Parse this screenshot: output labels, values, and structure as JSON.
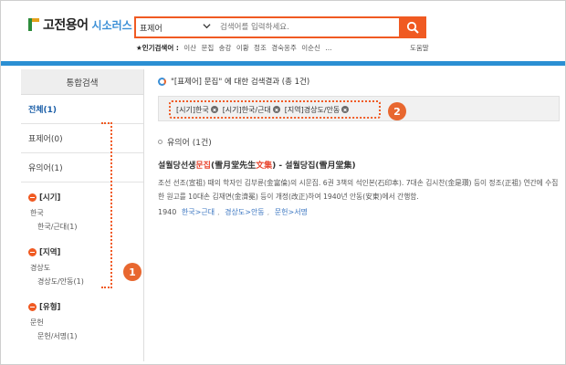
{
  "header": {
    "logo_main": "고전용어",
    "logo_sub": "시소러스",
    "search": {
      "select_value": "표제어",
      "placeholder": "검색어를 입력하세요."
    },
    "popular": {
      "label": "★인기검색어 :",
      "keywords": [
        "이산",
        "문집",
        "송강",
        "이황",
        "정조",
        "경숙옹주",
        "이순신",
        "..."
      ]
    },
    "help": "도움말"
  },
  "sidebar": {
    "title": "통합검색",
    "items": [
      {
        "label": "전체(1)",
        "active": true
      },
      {
        "label": "표제어(0)",
        "active": false
      },
      {
        "label": "유의어(1)",
        "active": false
      }
    ],
    "facets": [
      {
        "head": "[시기]",
        "item": "한국",
        "sub": "한국/근대(1)"
      },
      {
        "head": "[지역]",
        "item": "경상도",
        "sub": "경상도/안동(1)"
      },
      {
        "head": "[유형]",
        "item": "문헌",
        "sub": "문헌/서명(1)"
      }
    ]
  },
  "main": {
    "result_header": "\"[표제어] 문집\" 에 대한 검색결과 (총 1건)",
    "chips": [
      "[시기]한국",
      "[시기]한국/근대",
      "[지역]경상도/안동"
    ],
    "section_title": "유의어 (1건)",
    "entry": {
      "title_pre": "설월당선생",
      "title_hl": "문집",
      "title_mid": "(雪月堂先生",
      "title_hl2": "文集",
      "title_post": ")  - 설월당집(雪月堂集)",
      "desc": "조선 선조(宣祖) 때의 학자인 김부륜(金富倫)의 시문집. 6권 3책의 석인본(石印本). 7대손 김시찬(金是瓚) 등이 정조(正祖) 연간에 수집한 원고를 10대손 김재면(金濟冕) 등이 개정(改正)하여 1940년 안동(安東)에서 간행함.",
      "year": "1940",
      "links": [
        "한국>근대",
        "경상도>안동",
        "문헌>서명"
      ]
    }
  },
  "annotations": {
    "badge1": "1",
    "badge2": "2"
  },
  "colors": {
    "accent": "#f05a22",
    "blue_bar": "#2b8fd3",
    "link": "#3b76c1",
    "active": "#1c5fa8"
  }
}
